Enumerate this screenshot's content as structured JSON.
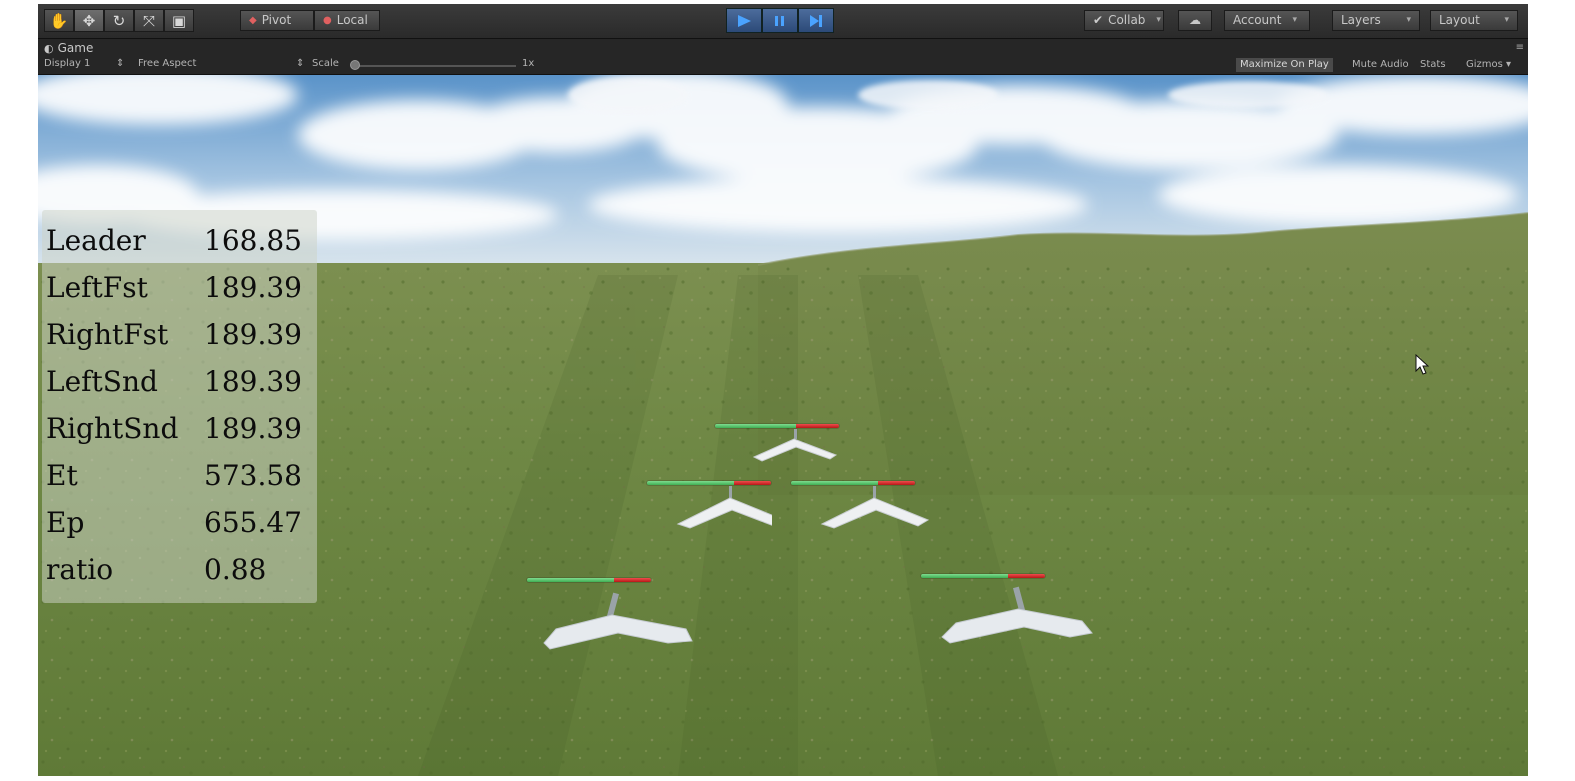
{
  "toolbar": {
    "pivot_label": "Pivot",
    "local_label": "Local",
    "collab_label": "Collab",
    "account_label": "Account",
    "layers_label": "Layers",
    "layout_label": "Layout",
    "tools": [
      "hand-tool-icon",
      "move-tool-icon",
      "rotate-tool-icon",
      "scale-tool-icon",
      "rect-tool-icon"
    ],
    "accent": "#3d6db5"
  },
  "game_view": {
    "tab_label": "Game",
    "display_label": "Display 1",
    "aspect_label": "Free Aspect",
    "scale_label": "Scale",
    "scale_value": "1x",
    "maximize_label": "Maximize On Play",
    "mute_label": "Mute Audio",
    "stats_label": "Stats",
    "gizmos_label": "Gizmos"
  },
  "stats": [
    {
      "label": "Leader",
      "value": "168.85"
    },
    {
      "label": "LeftFst",
      "value": "189.39"
    },
    {
      "label": "RightFst",
      "value": "189.39"
    },
    {
      "label": "LeftSnd",
      "value": "189.39"
    },
    {
      "label": "RightSnd",
      "value": "189.39"
    },
    {
      "label": "Et",
      "value": "573.58"
    },
    {
      "label": "Ep",
      "value": "655.47"
    },
    {
      "label": "ratio",
      "value": "0.88"
    }
  ],
  "drones": [
    {
      "name": "drone-leader",
      "health": 0.65
    },
    {
      "name": "drone-left-first",
      "health": 0.7
    },
    {
      "name": "drone-right-first",
      "health": 0.7
    },
    {
      "name": "drone-left-second",
      "health": 0.7
    },
    {
      "name": "drone-right-second",
      "health": 0.7
    }
  ]
}
